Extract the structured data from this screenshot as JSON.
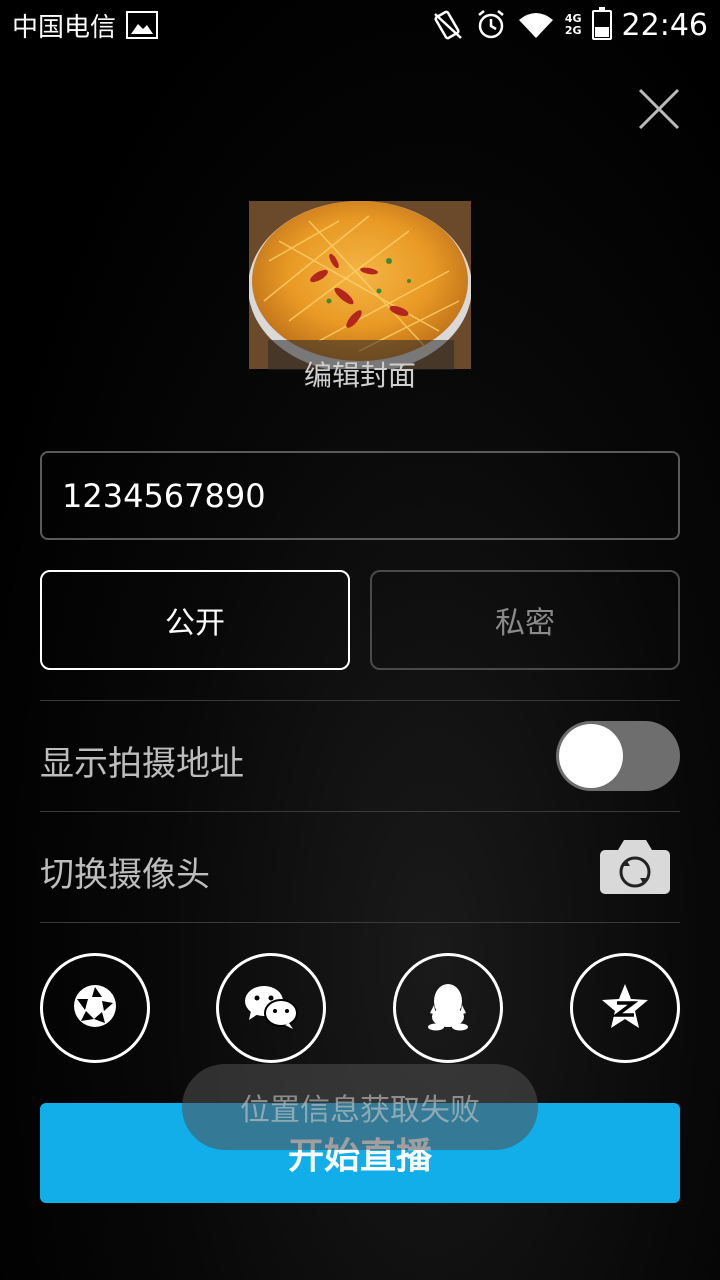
{
  "status_bar": {
    "carrier": "中国电信",
    "network_top": "4G",
    "network_bottom": "2G",
    "time": "22:46",
    "icons": [
      "gallery-icon",
      "vibrate-icon",
      "alarm-icon",
      "wifi-icon",
      "signal-icon",
      "battery-icon"
    ]
  },
  "cover": {
    "label": "编辑封面"
  },
  "title_input": {
    "value": "1234567890"
  },
  "privacy": {
    "public_label": "公开",
    "private_label": "私密",
    "selected": "public"
  },
  "settings": {
    "show_location_label": "显示拍摄地址",
    "show_location_on": false,
    "switch_camera_label": "切换摄像头"
  },
  "share_icons": [
    "moments-icon",
    "wechat-icon",
    "qq-icon",
    "qzone-icon"
  ],
  "start_button": {
    "label": "开始直播"
  },
  "toast": {
    "message": "位置信息获取失败"
  },
  "colors": {
    "accent": "#12aeea",
    "background": "#000000",
    "toggle_off": "#6e6e6e"
  }
}
